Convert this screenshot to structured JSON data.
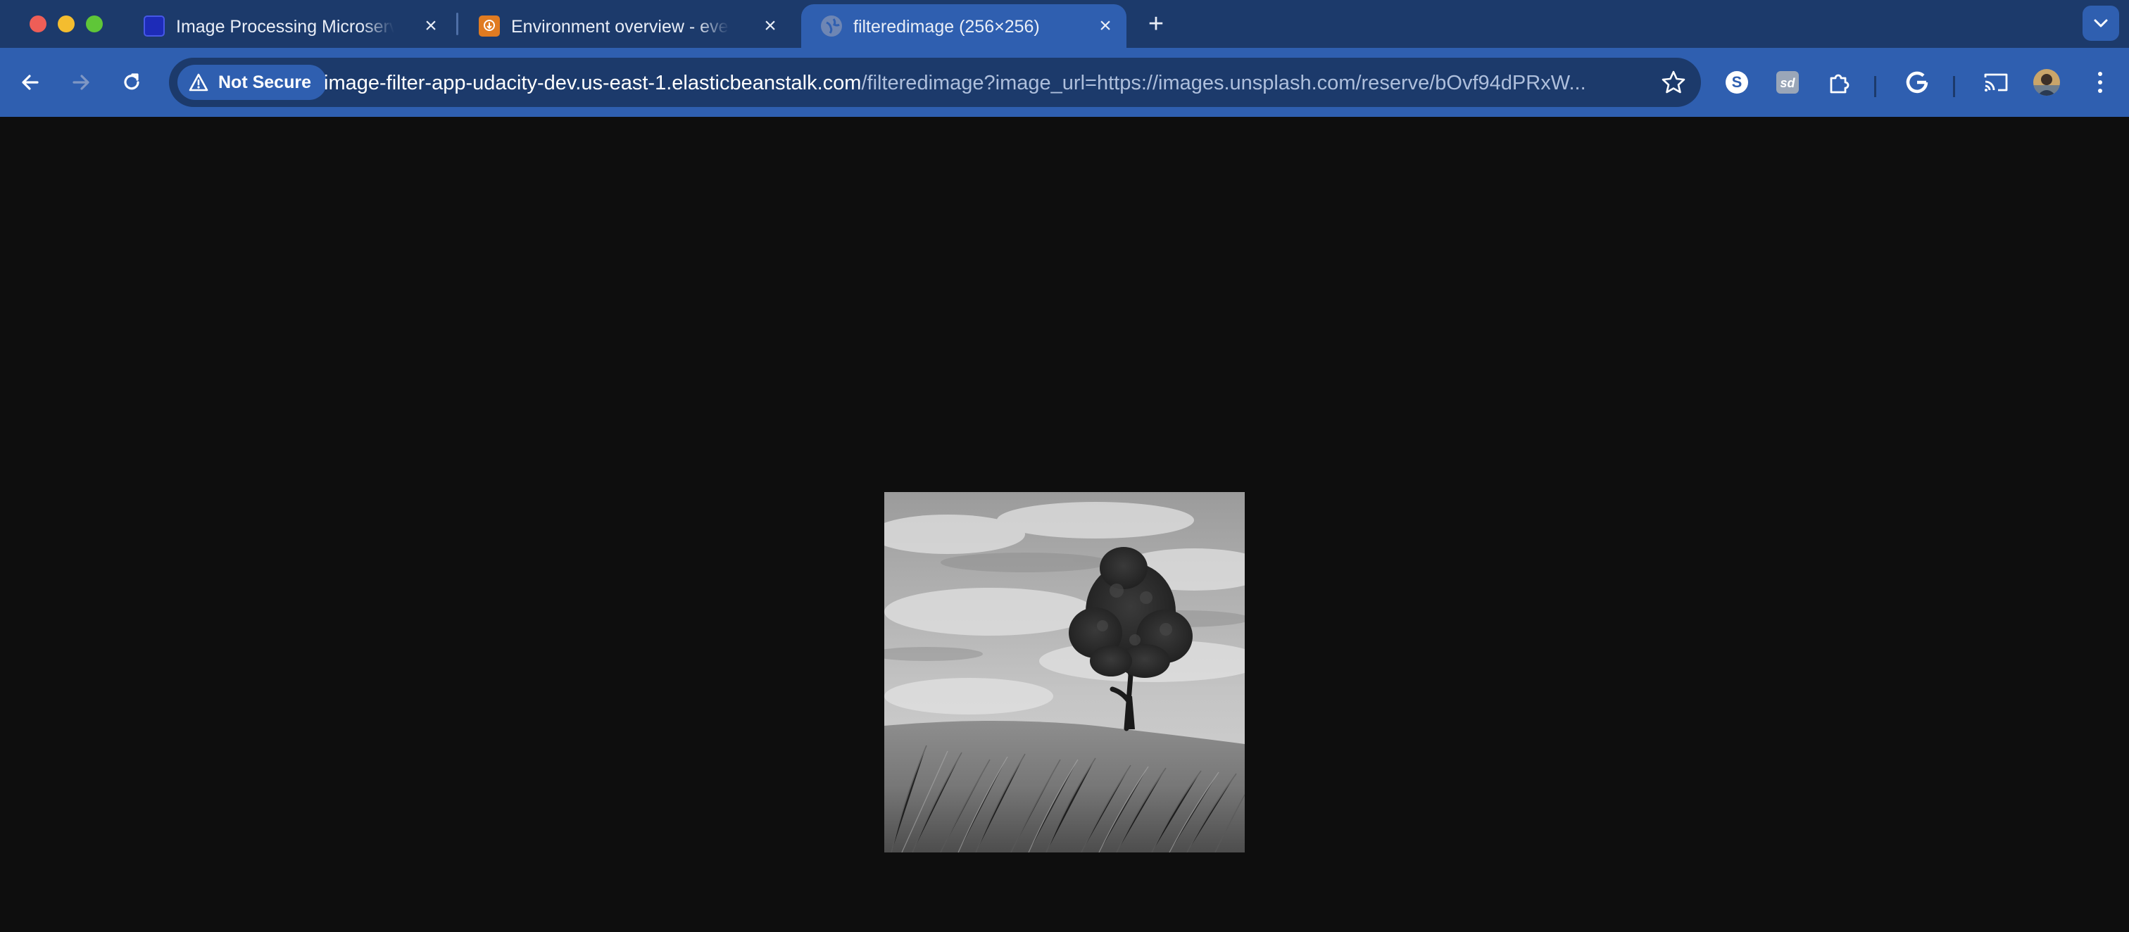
{
  "window": {
    "traffic_lights": [
      "close",
      "minimize",
      "maximize"
    ]
  },
  "tabs": [
    {
      "title": "Image Processing Microservice",
      "favicon": "vscode-like-blue-icon",
      "active": false
    },
    {
      "title": "Environment overview - events",
      "favicon": "elastic-beanstalk-icon",
      "active": false
    },
    {
      "title": "filteredimage (256×256)",
      "favicon": "globe-icon",
      "active": true
    }
  ],
  "toolbar": {
    "security_label": "Not Secure",
    "url_host": "image-filter-app-udacity-dev.us-east-1.elasticbeanstalk.com",
    "url_path": "/filteredimage?image_url=https://images.unsplash.com/reserve/bOvf94dPRxW...",
    "extensions": [
      "s-extension-icon",
      "sd-extension-icon",
      "puzzle-icon",
      "google-icon",
      "cast-icon",
      "profile-avatar",
      "kebab-menu-icon"
    ]
  },
  "content": {
    "image_description": "grayscale photo of a lone tree on a grassy hill",
    "image_size": "256×256"
  },
  "colors": {
    "tabstrip": "#1c3a6b",
    "toolbar": "#2f5fb0",
    "page_background": "#0e0e0e"
  }
}
